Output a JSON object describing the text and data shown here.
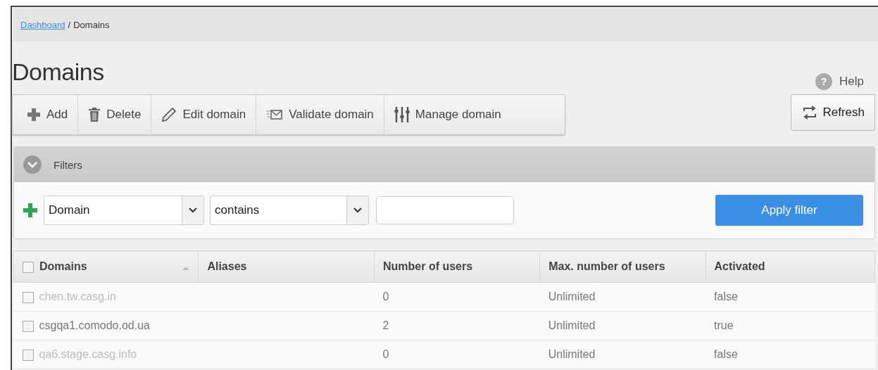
{
  "breadcrumb": {
    "link": "Dashboard",
    "separator": "/",
    "current": "Domains"
  },
  "title": "Domains",
  "help": {
    "icon": "?",
    "label": "Help"
  },
  "toolbar": [
    {
      "kind": "add",
      "label": "Add"
    },
    {
      "kind": "delete",
      "label": "Delete"
    },
    {
      "kind": "edit",
      "label": "Edit domain"
    },
    {
      "kind": "validate",
      "label": "Validate domain"
    },
    {
      "kind": "manage",
      "label": "Manage domain"
    }
  ],
  "refresh": {
    "label": "Refresh"
  },
  "filters": {
    "title": "Filters",
    "expanded": true,
    "field": "Domain",
    "operator": "contains",
    "apply": "Apply filter"
  },
  "table": {
    "columns": [
      {
        "label": "Domains",
        "checkbox": true,
        "checked": false,
        "sorted": true
      },
      {
        "label": "Aliases"
      },
      {
        "label": "Number of users"
      },
      {
        "label": "Max. number of users"
      },
      {
        "label": "Activated"
      }
    ],
    "rows": [
      {
        "domain": "chen.tw.casg.in",
        "users": "0",
        "max_users": "Unlimited",
        "activated": "false",
        "disabled": true,
        "checked": false
      },
      {
        "domain": "csgqa1.comodo.od.ua",
        "users": "2",
        "max_users": "Unlimited",
        "activated": "true",
        "disabled": false,
        "checked": false
      },
      {
        "domain": "qa6.stage.casg.info",
        "users": "0",
        "max_users": "Unlimited",
        "activated": "false",
        "disabled": true,
        "checked": false
      }
    ]
  }
}
